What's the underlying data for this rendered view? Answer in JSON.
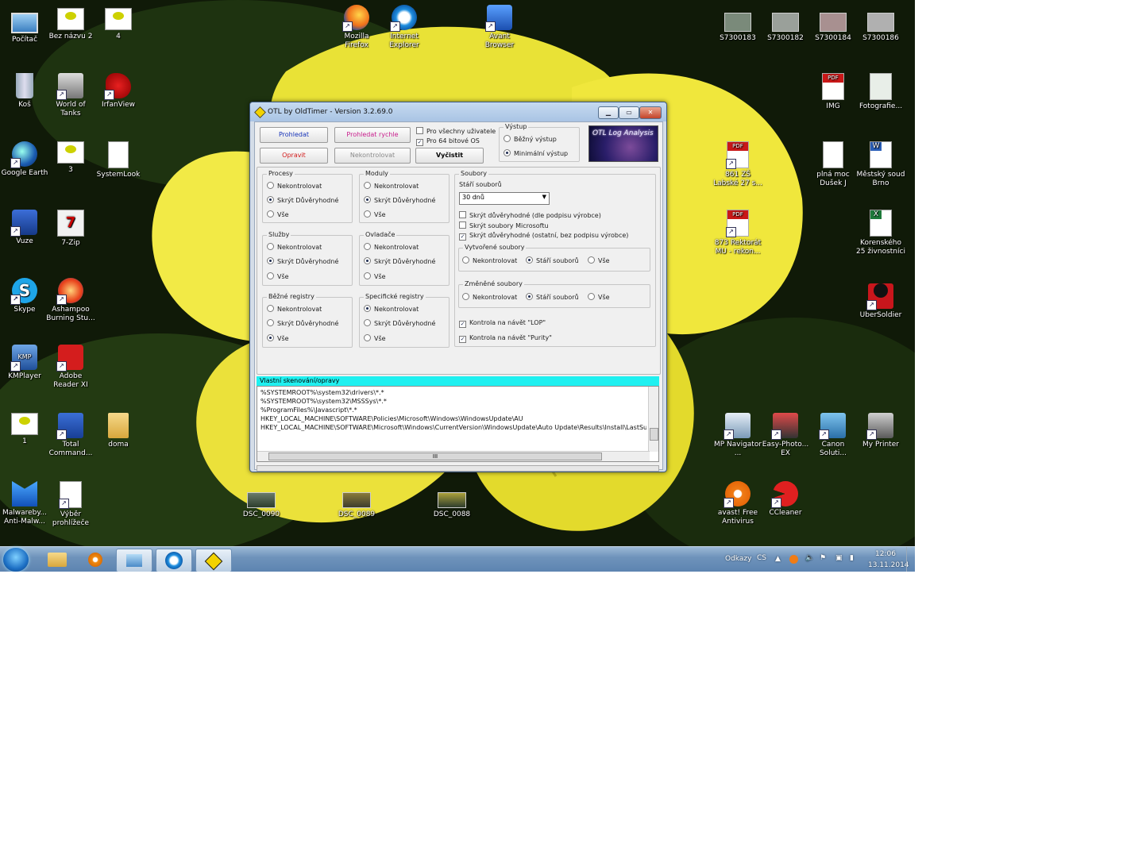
{
  "desktop_icons": {
    "pocitac": "Počítač",
    "beznazvu2": "Bez názvu 2",
    "four": "4",
    "firefox": "Mozilla Firefox",
    "ie": "Internet Explorer",
    "avant": "Avant Browser",
    "s183": "S7300183",
    "s182": "S7300182",
    "s184": "S7300184",
    "s186": "S7300186",
    "kos": "Koš",
    "wot": "World of Tanks",
    "irfan": "IrfanView",
    "img": "IMG",
    "fotografie": "Fotografie...",
    "gearth": "Google Earth",
    "three": "3",
    "systemlook": "SystemLook",
    "pdf861": "861 ZŠ Labské 27 s...",
    "plnamoc": "plná moc Dušek J",
    "mestsky": "Městský soud Brno",
    "vuze": "Vuze",
    "sevenzip": "7-Zip",
    "pdf873": "873 Rektorát MU - rekon...",
    "korenskeho": "Korenského 25 živnostníci",
    "skype": "Skype",
    "ashampoo": "Ashampoo Burning Stu...",
    "ubersoldier": "UberSoldier",
    "kmplayer": "KMPlayer",
    "adobe": "Adobe Reader XI",
    "one": "1",
    "totalcmd": "Total Command...",
    "doma": "doma",
    "mpnav": "MP Navigator ...",
    "easyphoto": "Easy-Photo... EX",
    "canon": "Canon Soluti...",
    "myprinter": "My Printer",
    "malwarebytes": "Malwareby... Anti-Malw...",
    "vyber": "Výběr prohlížeče",
    "dsc090": "DSC_0090",
    "dsc089": "DSC_0089",
    "dsc088": "DSC_0088",
    "avast": "avast! Free Antivirus",
    "ccleaner": "CCleaner"
  },
  "otl": {
    "title": "OTL by OldTimer - Version 3.2.69.0",
    "buttons": {
      "scan": "Prohledat",
      "quickscan": "Prohledat rychle",
      "fix": "Opravit",
      "noscan": "Nekontrolovat",
      "clear": "Vyčistit"
    },
    "top_checks": {
      "allusers": "Pro všechny uživatele",
      "bit64": "Pro 64 bitové OS"
    },
    "output": {
      "caption": "Výstup",
      "standard": "Běžný výstup",
      "minimal": "Minimální výstup"
    },
    "logo": "OTL Log Analysis",
    "processes": {
      "caption": "Procesy",
      "a": "Nekontrolovat",
      "b": "Skrýt Důvěryhodné",
      "c": "Vše"
    },
    "modules": {
      "caption": "Moduly",
      "a": "Nekontrolovat",
      "b": "Skrýt Důvěryhodné",
      "c": "Vše"
    },
    "services": {
      "caption": "Služby",
      "a": "Nekontrolovat",
      "b": "Skrýt Důvěryhodné",
      "c": "Vše"
    },
    "drivers": {
      "caption": "Ovladače",
      "a": "Nekontrolovat",
      "b": "Skrýt Důvěryhodné",
      "c": "Vše"
    },
    "stdreg": {
      "caption": "Běžné registry",
      "a": "Nekontrolovat",
      "b": "Skrýt Důvěryhodné",
      "c": "Vše"
    },
    "extreg": {
      "caption": "Specifické registry",
      "a": "Nekontrolovat",
      "b": "Skrýt Důvěryhodné",
      "c": "Vše"
    },
    "files": {
      "caption": "Soubory",
      "age_label": "Stáří souborů",
      "age_value": "30 dnů",
      "c1": "Skrýt důvěryhodné (dle podpisu výrobce)",
      "c2": "Skrýt soubory Microsoftu",
      "c3": "Skrýt důvěryhodné (ostatní, bez podpisu výrobce)",
      "created_caption": "Vytvořené soubory",
      "modified_caption": "Změněné soubory",
      "r_a": "Nekontrolovat",
      "r_b": "Stáří souborů",
      "r_c": "Vše",
      "lop": "Kontrola na návět \"LOP\"",
      "purity": "Kontrola na návět \"Purity\""
    },
    "custom_header": "Vlastní skenování/opravy",
    "custom_lines": [
      "%SYSTEMROOT%\\system32\\drivers\\*.*",
      "%SYSTEMROOT%\\system32\\MSSSys\\*.*",
      "%ProgramFiles%\\Javascript\\*.*",
      "HKEY_LOCAL_MACHINE\\SOFTWARE\\Policies\\Microsoft\\Windows\\WindowsUpdate\\AU",
      "HKEY_LOCAL_MACHINE\\SOFTWARE\\Microsoft\\Windows\\CurrentVersion\\WindowsUpdate\\Auto Update\\Results\\Install\\LastSuc"
    ],
    "scroll_mid": "III"
  },
  "taskbar": {
    "links": "Odkazy",
    "lang": "CS",
    "time": "12:06",
    "date": "13.11.2014"
  }
}
